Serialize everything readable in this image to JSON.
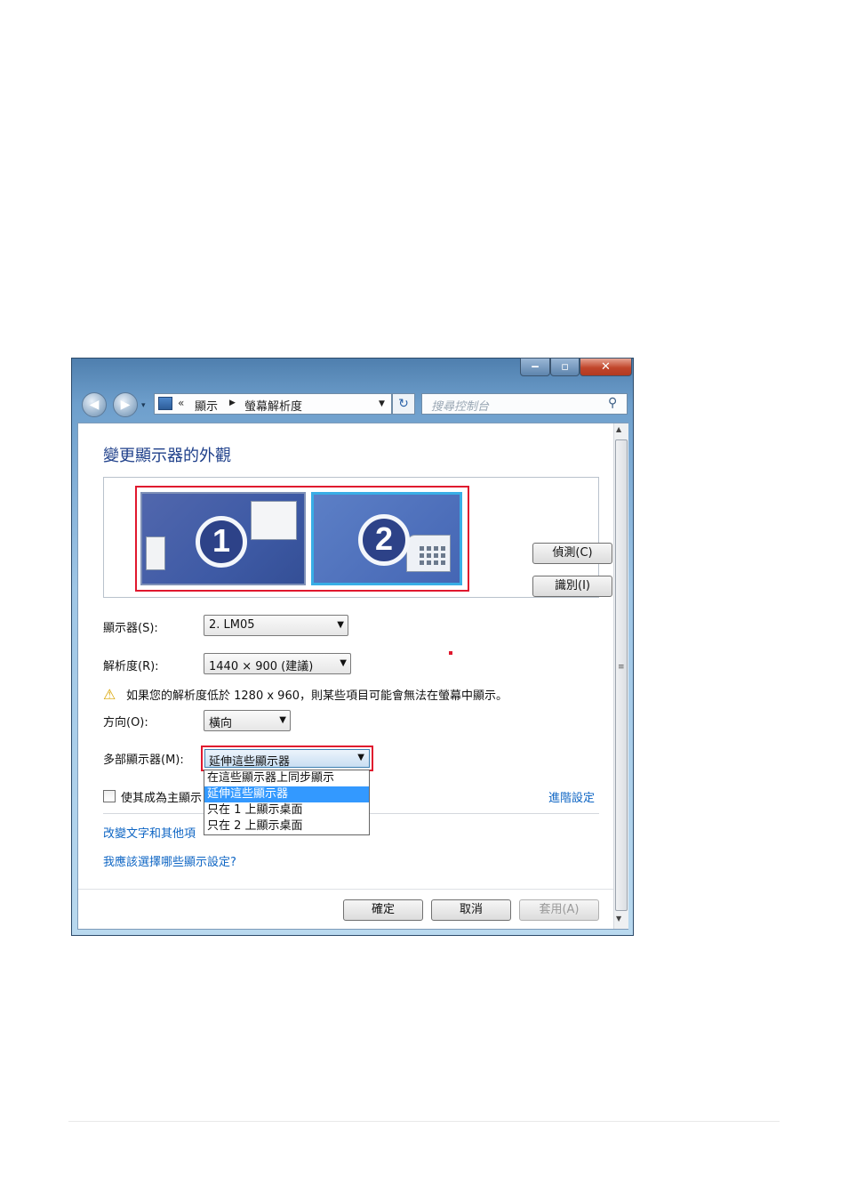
{
  "window": {
    "caption_buttons": {
      "minimize": "‒",
      "maximize": "▫",
      "close": "✕"
    }
  },
  "nav": {
    "breadcrumb_chevron": "«",
    "breadcrumb": [
      "顯示",
      "螢幕解析度"
    ],
    "search_placeholder": "搜尋控制台"
  },
  "page": {
    "title": "變更顯示器的外觀",
    "monitors": [
      {
        "number": "1"
      },
      {
        "number": "2"
      }
    ],
    "detect_button": "偵測(C)",
    "identify_button": "識別(I)",
    "display_label": "顯示器(S):",
    "display_value": "2. LM05",
    "resolution_label": "解析度(R):",
    "resolution_value": "1440 × 900 (建議)",
    "warning_text": "如果您的解析度低於 1280 x 960，則某些項目可能會無法在螢幕中顯示。",
    "orientation_label": "方向(O):",
    "orientation_value": "橫向",
    "multi_display_label": "多部顯示器(M):",
    "multi_display_value": "延伸這些顯示器",
    "multi_display_options": [
      "在這些顯示器上同步顯示",
      "延伸這些顯示器",
      "只在 1 上顯示桌面",
      "只在 2 上顯示桌面"
    ],
    "primary_checkbox_label": "使其成為主顯示",
    "advanced_link": "進階設定",
    "text_size_link": "改變文字和其他項",
    "which_settings_link": "我應該選擇哪些顯示設定?",
    "ok_button": "確定",
    "cancel_button": "取消",
    "apply_button": "套用(A)"
  },
  "colors": {
    "highlight": "#e0182e",
    "selection": "#3399ff",
    "link": "#0f66c4",
    "title": "#1e3f8a"
  }
}
